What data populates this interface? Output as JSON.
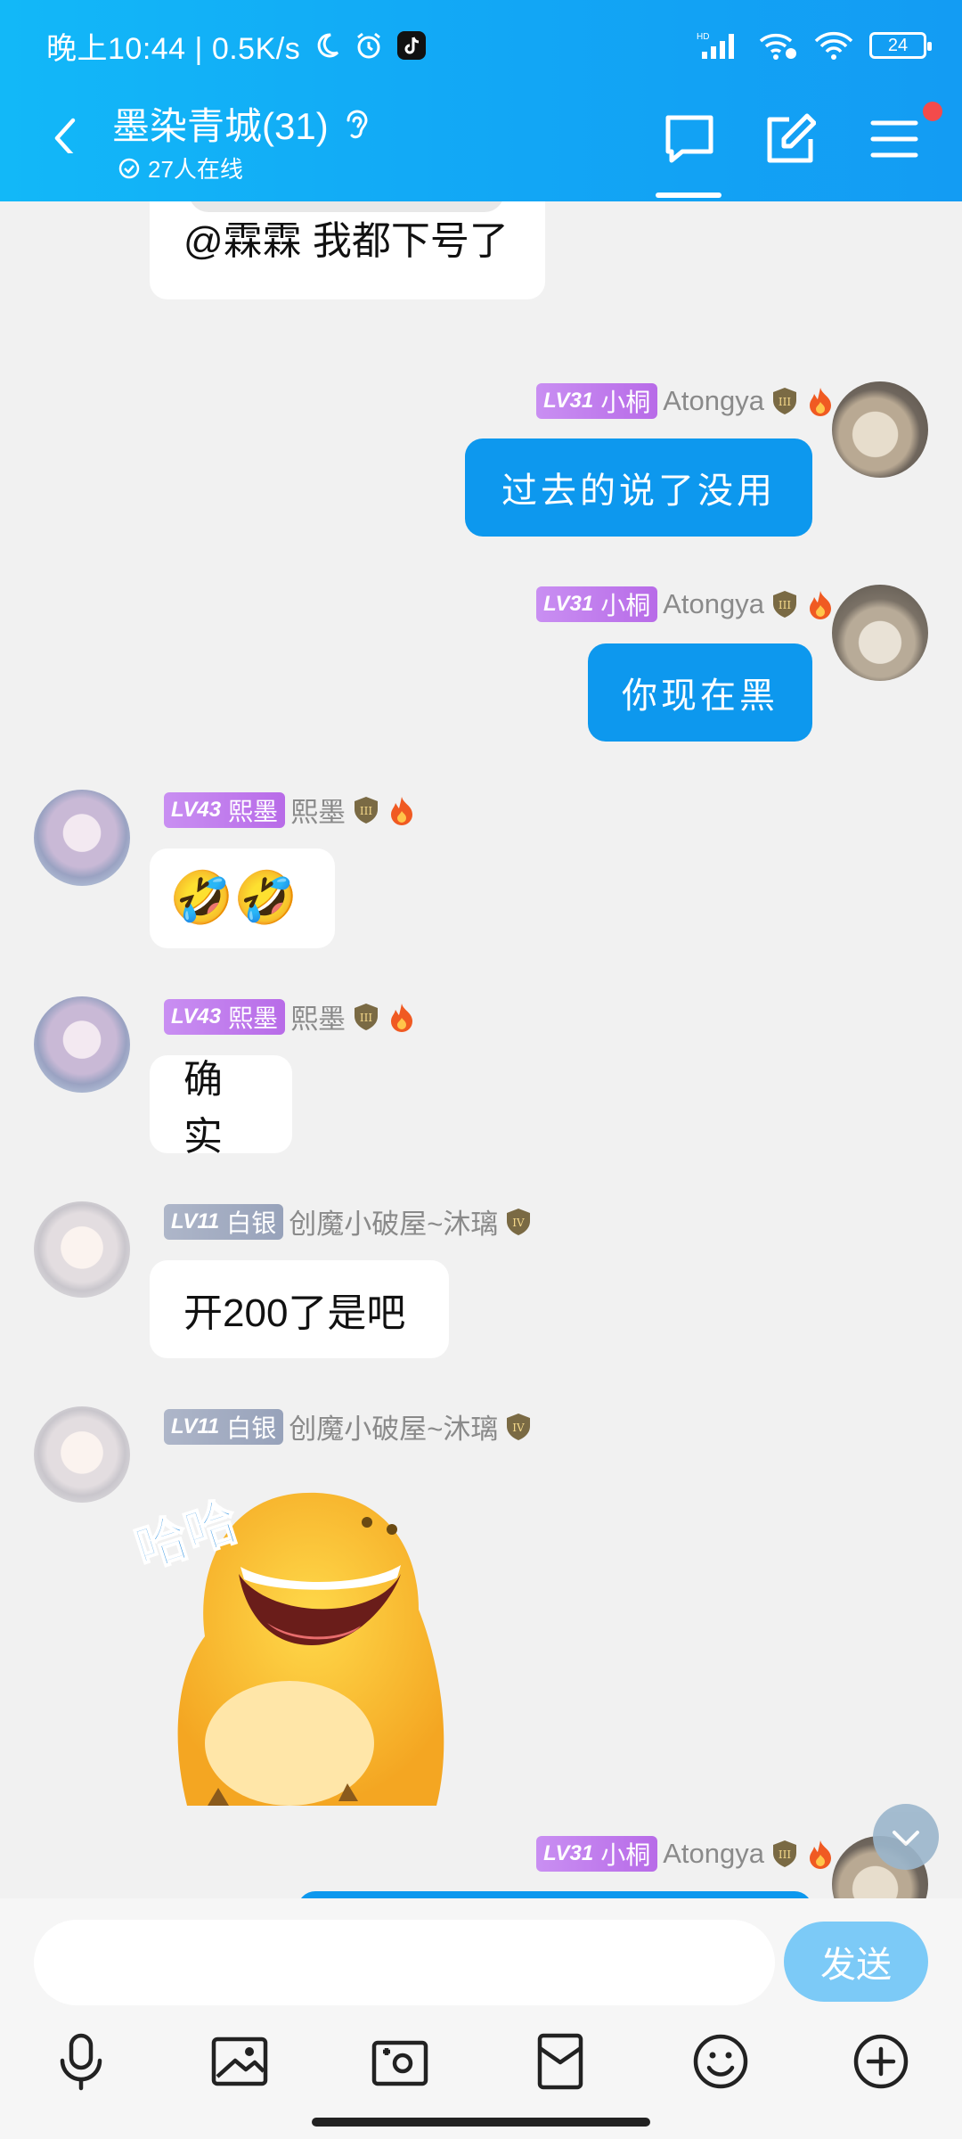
{
  "status_bar": {
    "time": "晚上10:44",
    "speed": "0.5K/s",
    "battery": "24"
  },
  "header": {
    "title": "墨染青城(31)",
    "online": "27人在线"
  },
  "messages": [
    {
      "text": "@霖霖 我都下号了"
    },
    {
      "level": "LV31",
      "tag": "小桐",
      "name": "Atongya",
      "text": "过去的说了没用"
    },
    {
      "level": "LV31",
      "tag": "小桐",
      "name": "Atongya",
      "text": "你现在黑"
    },
    {
      "level": "LV43",
      "tag": "熙墨",
      "name": "熙墨",
      "emoji": "🤣🤣"
    },
    {
      "level": "LV43",
      "tag": "熙墨",
      "name": "熙墨",
      "text": "确实"
    },
    {
      "level": "LV11",
      "tag": "白银",
      "name": "创魔小破屋~沐璃",
      "text": "开200了是吧"
    },
    {
      "level": "LV11",
      "tag": "白银",
      "name": "创魔小破屋~沐璃",
      "sticker_text": "哈哈"
    },
    {
      "level": "LV31",
      "tag": "小桐",
      "name": "Atongya"
    }
  ],
  "input": {
    "placeholder": "",
    "send_label": "发送"
  },
  "colors": {
    "header_blue": "#12a6f5",
    "my_bubble": "#0d98ee",
    "level_purple": "#b86be8",
    "level_gray": "#97a2ba"
  }
}
